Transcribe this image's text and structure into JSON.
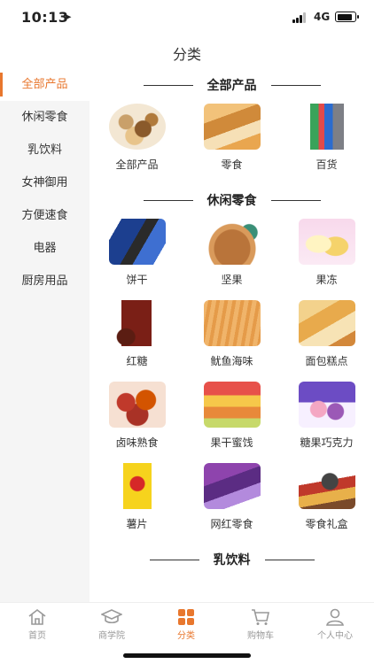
{
  "status": {
    "time": "10:13",
    "network": "4G"
  },
  "nav": {
    "title": "分类"
  },
  "sidebar": {
    "items": [
      {
        "label": "全部产品"
      },
      {
        "label": "休闲零食"
      },
      {
        "label": "乳饮料"
      },
      {
        "label": "女神御用"
      },
      {
        "label": "方便速食"
      },
      {
        "label": "电器"
      },
      {
        "label": "厨房用品"
      }
    ]
  },
  "sections": [
    {
      "title": "全部产品",
      "items": [
        {
          "label": "全部产品",
          "icon": "mixed-snacks-basket"
        },
        {
          "label": "零食",
          "icon": "snack-box"
        },
        {
          "label": "百货",
          "icon": "kettle-knives"
        }
      ]
    },
    {
      "title": "休闲零食",
      "items": [
        {
          "label": "饼干",
          "icon": "cookie-packs"
        },
        {
          "label": "坚果",
          "icon": "nut-bowl"
        },
        {
          "label": "果冻",
          "icon": "jelly-cakes"
        },
        {
          "label": "红糖",
          "icon": "brown-sugar-bag"
        },
        {
          "label": "鱿鱼海味",
          "icon": "squid-strips"
        },
        {
          "label": "面包糕点",
          "icon": "bread-box"
        },
        {
          "label": "卤味熟食",
          "icon": "braised-meat"
        },
        {
          "label": "果干蜜饯",
          "icon": "dried-fruit"
        },
        {
          "label": "糖果巧克力",
          "icon": "candy"
        },
        {
          "label": "薯片",
          "icon": "potato-chips-bag"
        },
        {
          "label": "网红零食",
          "icon": "trendy-snacks"
        },
        {
          "label": "零食礼盒",
          "icon": "gift-box"
        }
      ]
    },
    {
      "title": "乳饮料",
      "items": []
    }
  ],
  "tabbar": {
    "items": [
      {
        "label": "首页"
      },
      {
        "label": "商学院"
      },
      {
        "label": "分类"
      },
      {
        "label": "购物车"
      },
      {
        "label": "个人中心"
      }
    ]
  },
  "colors": {
    "accent": "#e8772e",
    "sidebar_bg": "#f5f5f5",
    "inactive": "#999999"
  }
}
